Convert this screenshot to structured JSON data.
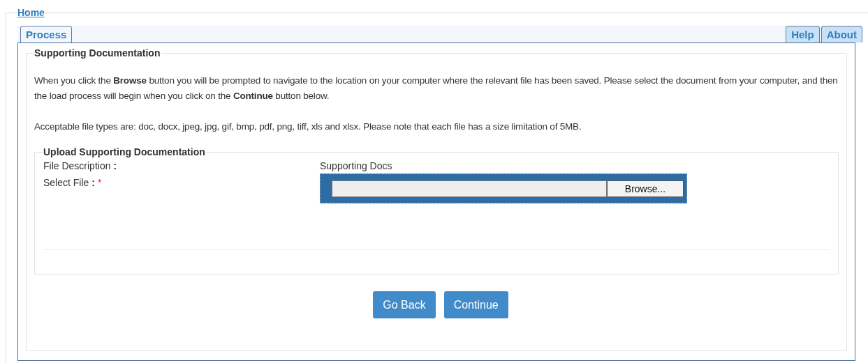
{
  "breadcrumb": {
    "link": "Home"
  },
  "tabs_left": [
    {
      "label": "Process",
      "selected": true
    }
  ],
  "tabs_right": [
    {
      "label": "Help",
      "selected": false
    },
    {
      "label": "About",
      "selected": false
    }
  ],
  "section": {
    "title": "Supporting Documentation",
    "paragraphs": [
      "When you click the **Browse** button you will be prompted to navigate to the location on your computer where the relevant file has been saved. Please select the document from your computer, and then the load process will begin when you click on the **Continue** button below.",
      "Acceptable file types are: doc, docx, jpeg, jpg, gif, bmp, pdf, png, tiff, xls and xlsx. Please note that each file has a size limitation of 5MB."
    ],
    "upload": {
      "title": "Upload Supporting Documentation",
      "fields": [
        {
          "kind": "text",
          "label": "File Description",
          "colon": ":",
          "value": "Supporting Docs"
        },
        {
          "kind": "file",
          "label": "Select File",
          "colon": ":",
          "required_mark": "*",
          "button": "Browse..."
        }
      ]
    }
  },
  "buttons": [
    "Go Back",
    "Continue"
  ]
}
